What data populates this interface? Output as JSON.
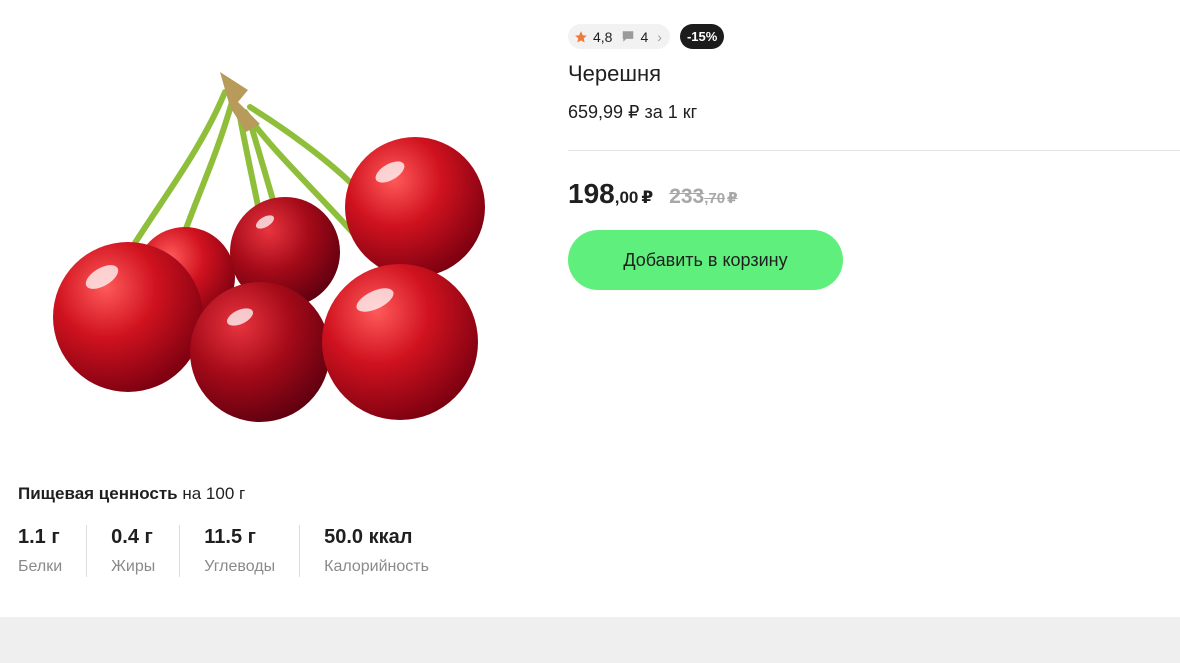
{
  "product": {
    "title": "Черешня",
    "rating": "4,8",
    "reviews_count": "4",
    "discount_badge": "-15%",
    "unit_price": "659,99 ₽ за 1 кг",
    "price": {
      "main": "198",
      "cents": ",00",
      "currency": "₽"
    },
    "old_price": {
      "main": "233",
      "cents": ",70",
      "currency": "₽"
    },
    "add_to_cart_label": "Добавить в корзину",
    "image_icon": "cherries-photo"
  },
  "nutrition": {
    "title_strong": "Пищевая ценность",
    "title_rest": " на 100 г",
    "items": [
      {
        "value": "1.1 г",
        "label": "Белки"
      },
      {
        "value": "0.4 г",
        "label": "Жиры"
      },
      {
        "value": "11.5 г",
        "label": "Углеводы"
      },
      {
        "value": "50.0 ккал",
        "label": "Калорийность"
      }
    ]
  },
  "colors": {
    "accent_button": "#5fef7d",
    "rating_star": "#f07a3a",
    "discount_badge_bg": "#1c1c1c",
    "cherry_red": "#c8102e"
  }
}
